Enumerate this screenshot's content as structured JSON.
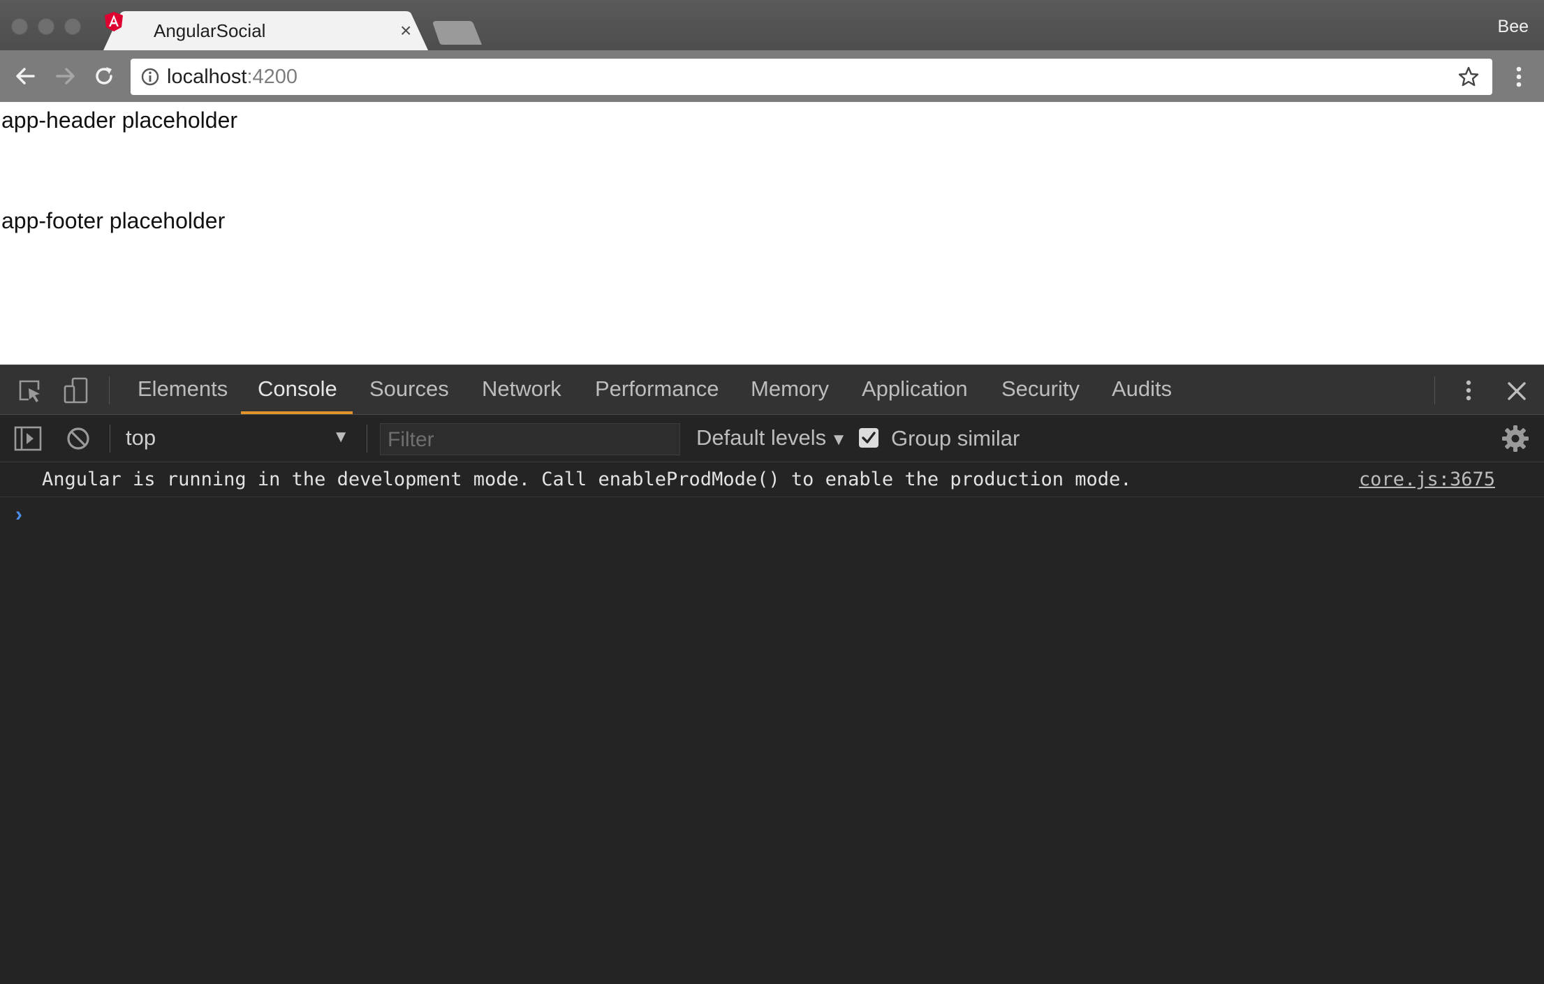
{
  "browser": {
    "tab": {
      "title": "AngularSocial",
      "close": "×"
    },
    "profile": "Bee",
    "address": {
      "host": "localhost",
      "port": ":4200"
    }
  },
  "page": {
    "header_placeholder": "app-header placeholder",
    "footer_placeholder": "app-footer placeholder"
  },
  "devtools": {
    "tabs": [
      {
        "label": "Elements"
      },
      {
        "label": "Console"
      },
      {
        "label": "Sources"
      },
      {
        "label": "Network"
      },
      {
        "label": "Performance"
      },
      {
        "label": "Memory"
      },
      {
        "label": "Application"
      },
      {
        "label": "Security"
      },
      {
        "label": "Audits"
      }
    ],
    "active_tab": "Console",
    "toolbar": {
      "context": "top",
      "filter_placeholder": "Filter",
      "levels": "Default levels",
      "group_similar_label": "Group similar",
      "group_similar_checked": true
    },
    "console": {
      "messages": [
        {
          "text": "Angular is running in the development mode. Call enableProdMode() to enable the production mode.",
          "source": "core.js:3675"
        }
      ],
      "prompt": "›"
    }
  },
  "colors": {
    "accent_tab_underline": "#e0952a",
    "prompt_blue": "#4b8fe8",
    "angular_red": "#dd0031"
  },
  "icons": [
    "angular-logo-icon",
    "close-icon",
    "back-arrow-icon",
    "forward-arrow-icon",
    "reload-icon",
    "info-icon",
    "star-icon",
    "more-vert-icon",
    "inspect-element-icon",
    "device-toolbar-icon",
    "sidebar-toggle-icon",
    "clear-console-icon",
    "gear-icon"
  ]
}
